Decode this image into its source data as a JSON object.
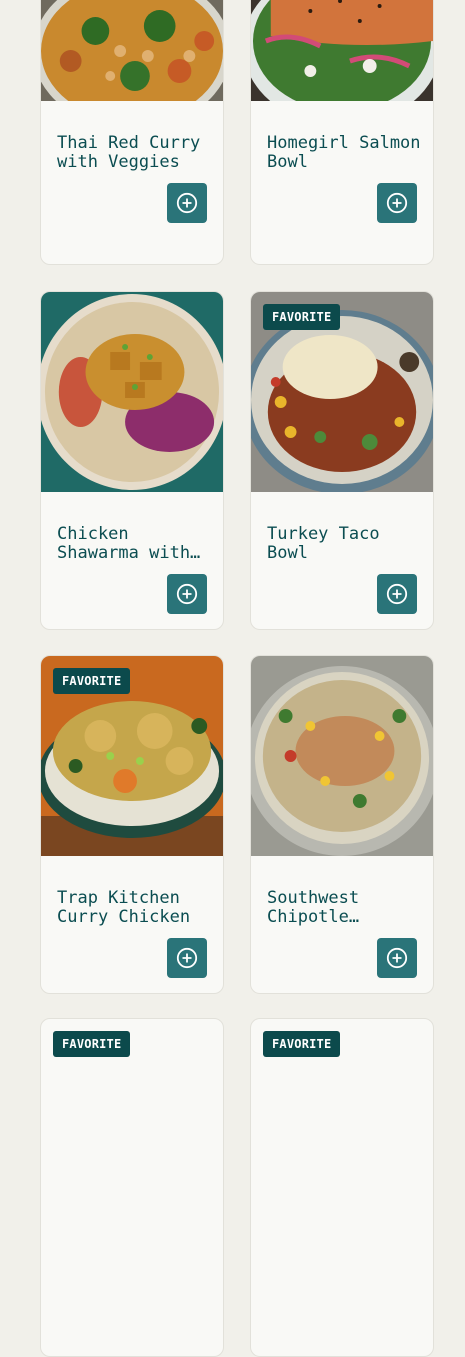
{
  "colors": {
    "background": "#f1f0ea",
    "card": "#f9f9f6",
    "title_text": "#0b4d51",
    "badge_bg": "#0c4a4c",
    "add_button_bg": "#2a7479"
  },
  "meals": [
    {
      "title": "Thai Red Curry with Veggies",
      "favorite": false,
      "badge": ""
    },
    {
      "title": "Homegirl Salmon Bowl",
      "favorite": false,
      "badge": ""
    },
    {
      "title": "Chicken Shawarma with…",
      "favorite": false,
      "badge": ""
    },
    {
      "title": "Turkey Taco Bowl",
      "favorite": true,
      "badge": "FAVORITE"
    },
    {
      "title": "Trap Kitchen Curry Chicken",
      "favorite": true,
      "badge": "FAVORITE"
    },
    {
      "title": "Southwest Chipotle…",
      "favorite": false,
      "badge": ""
    },
    {
      "title": "",
      "favorite": true,
      "badge": "FAVORITE"
    },
    {
      "title": "",
      "favorite": true,
      "badge": "FAVORITE"
    }
  ],
  "icons": {
    "add": "plus-circle-icon"
  }
}
